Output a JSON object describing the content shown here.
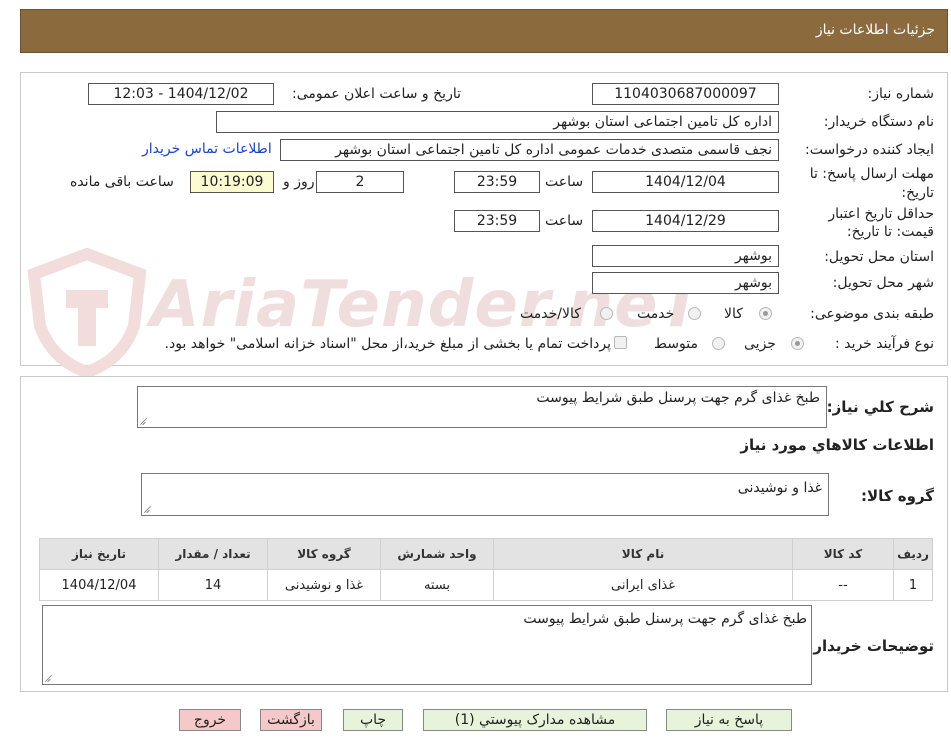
{
  "header": {
    "title": "جزئیات اطلاعات نیاز"
  },
  "watermark": "AriaTender.neT",
  "fields": {
    "need_number_label": "شماره نیاز:",
    "need_number": "1104030687000097",
    "announce_label": "تاریخ و ساعت اعلان عمومی:",
    "announce_value": "1404/12/02 - 12:03",
    "buyer_org_label": "نام دستگاه خریدار:",
    "buyer_org": "اداره کل تامین اجتماعی استان بوشهر",
    "creator_label": "ایجاد کننده درخواست:",
    "creator": "نجف قاسمی متصدی خدمات عمومی اداره کل تامین اجتماعی استان بوشهر",
    "contact_link": "اطلاعات تماس خریدار",
    "reply_deadline_label_1": "مهلت ارسال پاسخ: تا",
    "reply_deadline_label_2": "تاریخ:",
    "reply_date": "1404/12/04",
    "hour_label": "ساعت",
    "reply_time": "23:59",
    "days_value": "2",
    "days_label": "روز و",
    "remaining_time": "10:19:09",
    "remaining_label": "ساعت باقی مانده",
    "validity_label_1": "حداقل تاریخ اعتبار",
    "validity_label_2": "قیمت: تا تاریخ:",
    "validity_date": "1404/12/29",
    "validity_hour_label": "ساعت",
    "validity_time": "23:59",
    "province_label": "استان محل تحویل:",
    "province": "بوشهر",
    "city_label": "شهر محل تحویل:",
    "city": "بوشهر",
    "category_label": "طبقه بندی موضوعی:",
    "category_options": [
      "کالا",
      "خدمت",
      "کالا/خدمت"
    ],
    "process_label": "نوع فرآیند خرید :",
    "process_options": [
      "جزیی",
      "متوسط"
    ],
    "payment_note": "پرداخت تمام یا بخشی از مبلغ خرید،از محل \"اسناد خزانه اسلامی\" خواهد بود."
  },
  "summary": {
    "general_desc_label": "شرح کلي نياز:",
    "general_desc": "طبخ غذای گرم جهت پرسنل طبق شرایط پیوست",
    "goods_info_title": "اطلاعات کالاهاي مورد نياز",
    "goods_group_label": "گروه کالا:",
    "goods_group": "غذا و نوشیدنی"
  },
  "table": {
    "headers": [
      "رديف",
      "کد کالا",
      "نام کالا",
      "واحد شمارش",
      "گروه کالا",
      "تعداد / مقدار",
      "تاريخ نياز"
    ],
    "rows": [
      [
        "1",
        "--",
        "غذای ایرانی",
        "بسته",
        "غذا و نوشیدنی",
        "14",
        "1404/12/04"
      ]
    ]
  },
  "buyer_notes": {
    "label": "توضیحات خریدار:",
    "text": "طبخ غذای گرم جهت پرسنل طبق شرایط پیوست"
  },
  "buttons": {
    "reply": "پاسخ به نیاز",
    "view_docs": "مشاهده مدارک پیوستي (1)",
    "print": "چاپ",
    "back": "بازگشت",
    "exit": "خروج"
  }
}
